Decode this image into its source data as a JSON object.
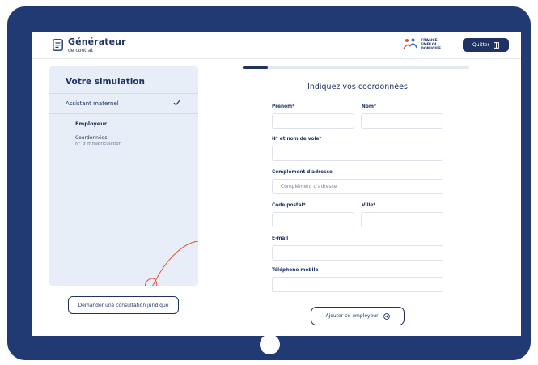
{
  "header": {
    "logo_title": "Générateur",
    "logo_subtitle": "de contrat",
    "partner_lines": [
      "FRANCE",
      "EMPLOI",
      "DOMICILE"
    ],
    "quit_label": "Quitter"
  },
  "sidebar": {
    "title": "Votre simulation",
    "item_label": "Assistant maternel",
    "sub_current": "Employeur",
    "sub_next": "Coordonnées",
    "sub_next_detail": "N° d'immatriculation"
  },
  "consult_button_label": "Demander une consultation juridique",
  "progress": {
    "fraction": 0.11
  },
  "form": {
    "title": "Indiquez vos coordonnées",
    "fields": {
      "prenom": {
        "label": "Prénom*",
        "value": "",
        "placeholder": ""
      },
      "nom": {
        "label": "Nom*",
        "value": "",
        "placeholder": ""
      },
      "voie": {
        "label": "N° et nom de voie*",
        "value": "",
        "placeholder": ""
      },
      "complement": {
        "label": "Complément d'adresse",
        "value": "",
        "placeholder": "Complément d'adresse"
      },
      "code_postal": {
        "label": "Code postal*",
        "value": "",
        "placeholder": ""
      },
      "ville": {
        "label": "Ville*",
        "value": "",
        "placeholder": ""
      },
      "email": {
        "label": "E-mail",
        "value": "",
        "placeholder": ""
      },
      "telephone": {
        "label": "Téléphone mobile",
        "value": "",
        "placeholder": ""
      }
    },
    "add_coemployer_label": "Ajouter co-employeur"
  },
  "colors": {
    "frame": "#223a74",
    "brand": "#1e3264",
    "sidebar_bg": "#e8eef8",
    "accent_red": "#e0523f"
  }
}
